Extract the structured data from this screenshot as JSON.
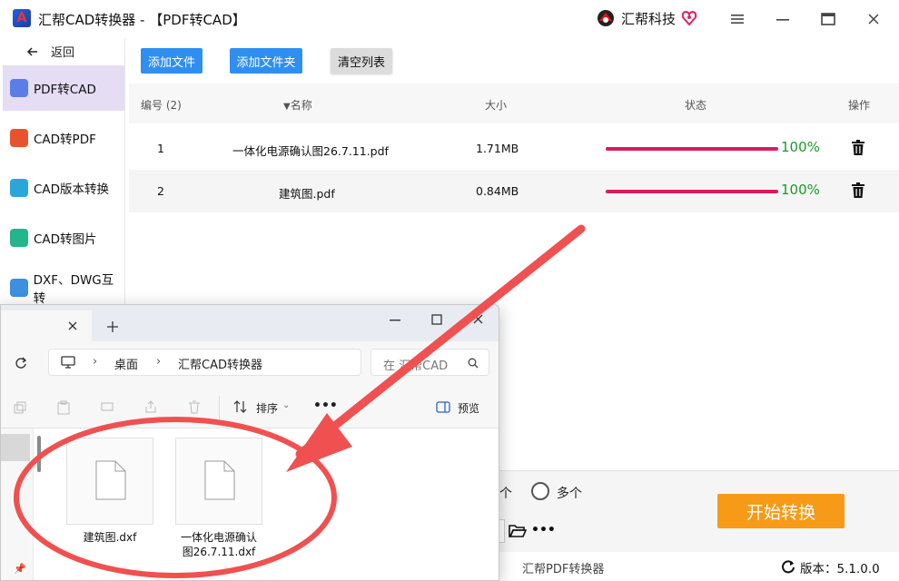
{
  "app": {
    "title": "汇帮CAD转换器 - 【PDF转CAD】",
    "brand": "汇帮科技",
    "logo_letter": "A"
  },
  "sidebar": {
    "back_label": "返回",
    "items": [
      {
        "label": "PDF转CAD",
        "icon": "pdf-to-cad-icon",
        "active": true
      },
      {
        "label": "CAD转PDF",
        "icon": "cad-to-pdf-icon"
      },
      {
        "label": "CAD版本转换",
        "icon": "cad-version-icon"
      },
      {
        "label": "CAD转图片",
        "icon": "cad-to-image-icon"
      },
      {
        "label": "DXF、DWG互转",
        "icon": "dxf-dwg-icon"
      }
    ]
  },
  "toolbar": {
    "add_file": "添加文件",
    "add_folder": "添加文件夹",
    "clear_list": "清空列表"
  },
  "table": {
    "headers": {
      "index": "编号 (2)",
      "name": "名称",
      "size": "大小",
      "status": "状态",
      "action": "操作"
    },
    "rows": [
      {
        "index": "1",
        "name": "一体化电源确认图26.7.11.pdf",
        "size": "1.71MB",
        "progress": 100,
        "progress_label": "100%"
      },
      {
        "index": "2",
        "name": "建筑图.pdf",
        "size": "0.84MB",
        "progress": 100,
        "progress_label": "100%"
      }
    ]
  },
  "options": {
    "single_partial": "个",
    "multi_label": "多个"
  },
  "start_button": "开始转换",
  "status_bar": {
    "product": "汇帮PDF转换器",
    "version": "版本：5.1.0.0"
  },
  "explorer": {
    "breadcrumb": [
      "桌面",
      "汇帮CAD转换器"
    ],
    "search_placeholder": "在 汇帮CAD",
    "sort_label": "排序",
    "preview_label": "预览",
    "more": "•••",
    "files": [
      {
        "name": "建筑图.dxf"
      },
      {
        "name_line1": "一体化电源确认",
        "name_line2": "图26.7.11.dxf"
      }
    ]
  },
  "colors": {
    "accent_blue": "#2f8ff0",
    "progress": "#d81b60",
    "percent_green": "#1a9a2a",
    "start_orange": "#f79a17",
    "annotation_red": "#f05050",
    "active_nav": "#e4ddf3"
  }
}
